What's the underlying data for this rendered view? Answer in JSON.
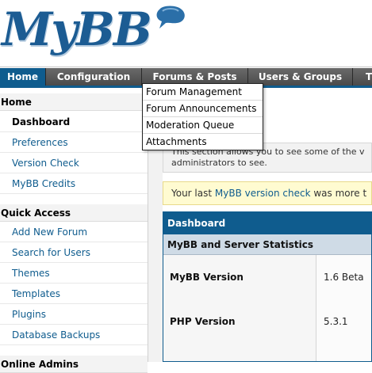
{
  "logo": {
    "text": "MyBB"
  },
  "tabs": [
    {
      "label": "Home",
      "active": true
    },
    {
      "label": "Configuration"
    },
    {
      "label": "Forums & Posts"
    },
    {
      "label": "Users & Groups"
    },
    {
      "label": "T"
    }
  ],
  "dropdown": {
    "items": [
      "Forum Management",
      "Forum Announcements",
      "Moderation Queue",
      "Attachments"
    ]
  },
  "sidebar": {
    "home": {
      "title": "Home",
      "items": [
        "Dashboard",
        "Preferences",
        "Version Check",
        "MyBB Credits"
      ]
    },
    "quick_access": {
      "title": "Quick Access",
      "items": [
        "Add New Forum",
        "Search for Users",
        "Themes",
        "Templates",
        "Plugins",
        "Database Backups"
      ]
    },
    "next_section_title": "Online Admins"
  },
  "notice": {
    "line1": "This section allows you to see some of the v",
    "line2": "administrators to see."
  },
  "version_notice": {
    "prefix": "Your last ",
    "link": "MyBB version check",
    "suffix": " was more t"
  },
  "dashboard": {
    "title": "Dashboard",
    "subtitle": "MyBB and Server Statistics",
    "rows": [
      {
        "label": "MyBB Version",
        "value": "1.6 Beta"
      },
      {
        "label": "PHP Version",
        "value": "5.3.1"
      }
    ]
  },
  "colors": {
    "accent": "#0f5c8e",
    "notice_yellow": "#fffbd1"
  }
}
